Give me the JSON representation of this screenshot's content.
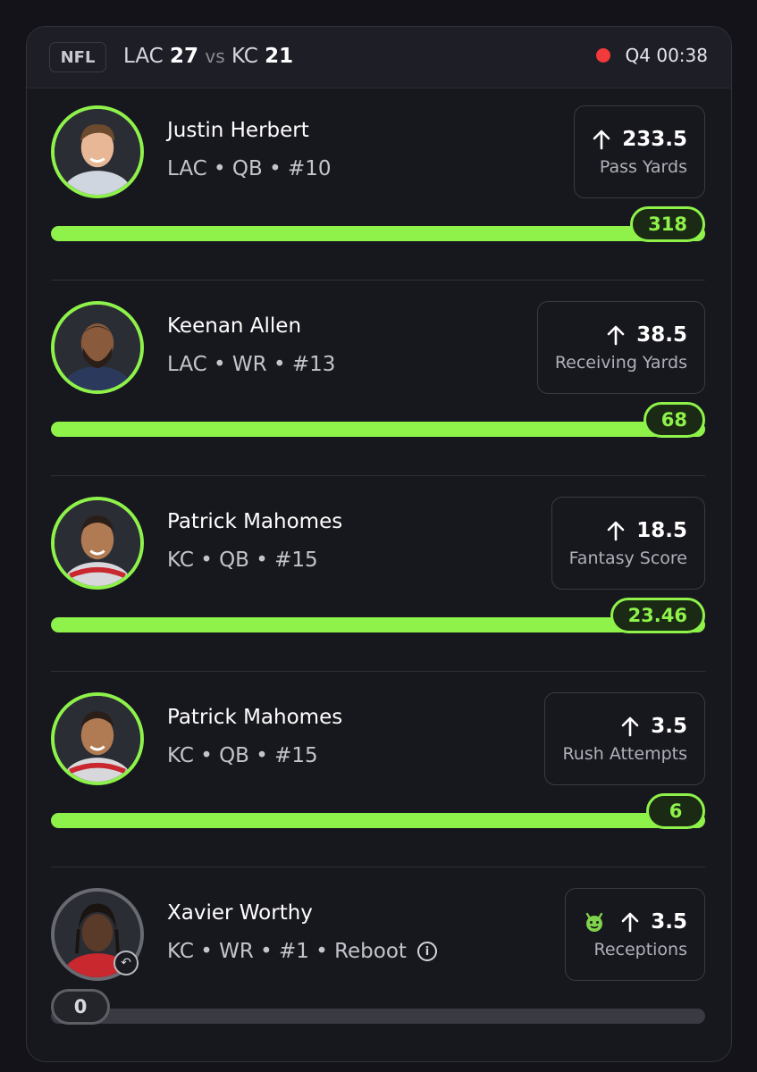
{
  "header": {
    "league": "NFL",
    "away_team": "LAC",
    "away_score": "27",
    "vs": "vs",
    "home_team": "KC",
    "home_score": "21",
    "game_clock": "Q4 00:38"
  },
  "players": [
    {
      "name": "Justin Herbert",
      "meta": "LAC • QB • #10",
      "line": "233.5",
      "stat": "Pass Yards",
      "current": "318",
      "progress": 1.0
    },
    {
      "name": "Keenan Allen",
      "meta": "LAC • WR • #13",
      "line": "38.5",
      "stat": "Receiving Yards",
      "current": "68",
      "progress": 1.0
    },
    {
      "name": "Patrick Mahomes",
      "meta": "KC • QB • #15",
      "line": "18.5",
      "stat": "Fantasy Score",
      "current": "23.46",
      "progress": 1.0
    },
    {
      "name": "Patrick Mahomes",
      "meta": "KC • QB • #15",
      "line": "3.5",
      "stat": "Rush Attempts",
      "current": "6",
      "progress": 1.0
    },
    {
      "name": "Xavier Worthy",
      "meta": "KC • WR • #1 • Reboot",
      "line": "3.5",
      "stat": "Receptions",
      "current": "0",
      "progress": 0.0
    }
  ],
  "colors": {
    "accent": "#8ef24a",
    "live": "#f23a3a",
    "background": "#131319"
  }
}
